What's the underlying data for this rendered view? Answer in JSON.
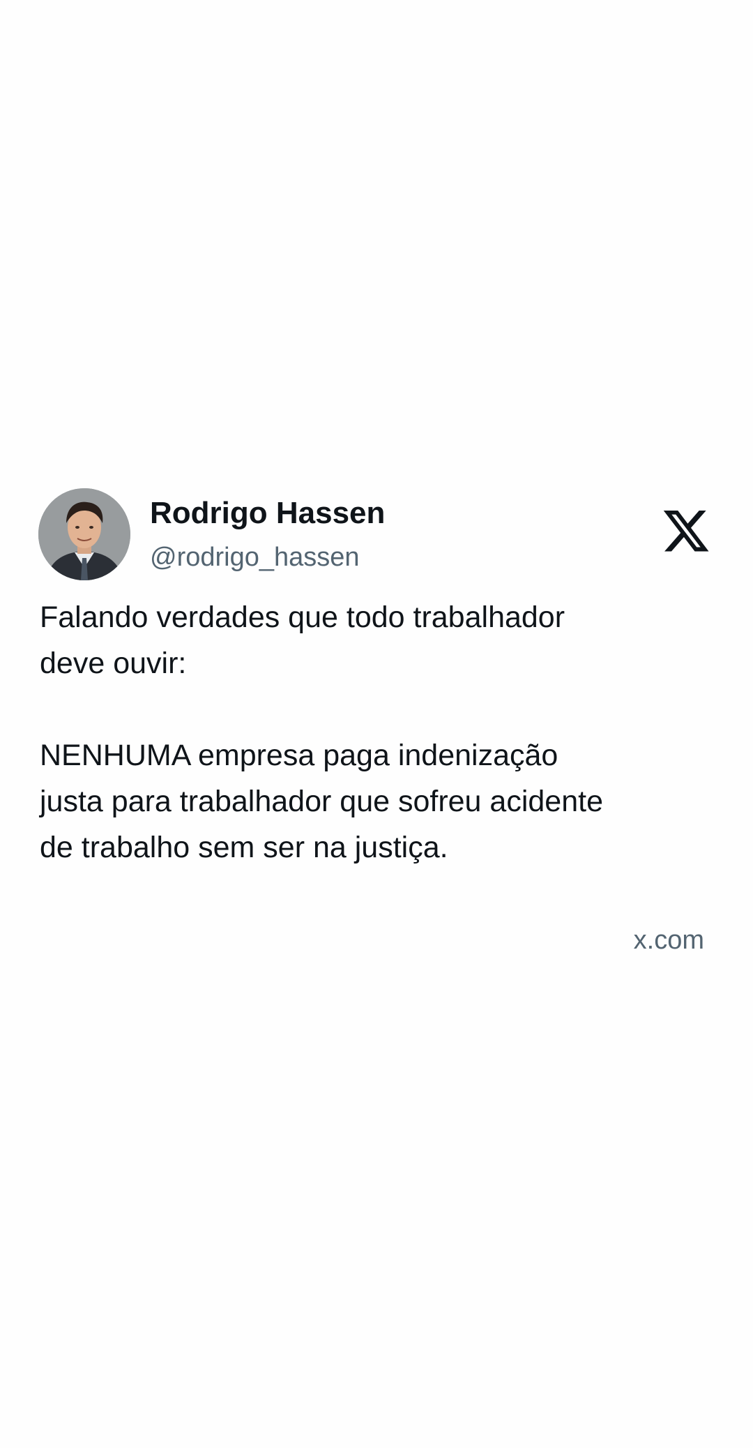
{
  "tweet": {
    "author": {
      "name": "Rodrigo Hassen",
      "handle": "@rodrigo_hassen"
    },
    "platform_icon": "x-logo-icon",
    "paragraphs": [
      "Falando verdades que todo trabalhador\ndeve ouvir:",
      "NENHUMA empresa paga indenização\njusta para trabalhador que sofreu acidente\nde trabalho sem ser na justiça."
    ],
    "source": "x.com"
  }
}
